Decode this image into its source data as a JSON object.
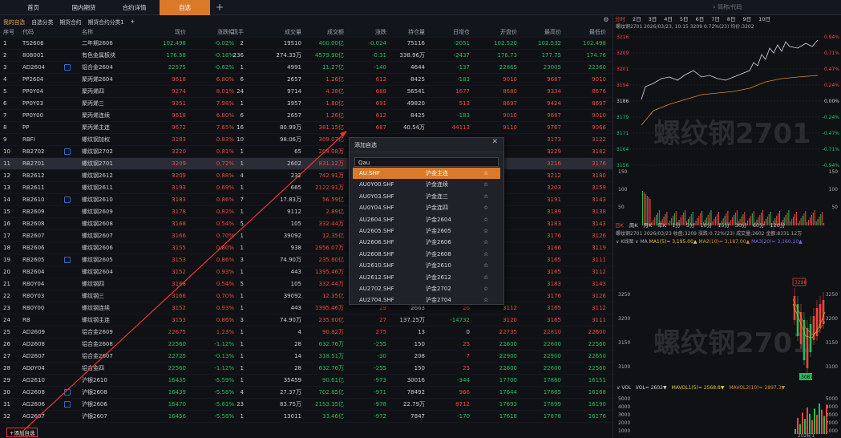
{
  "top_tabs": [
    "首页",
    "国内期货",
    "合约详情",
    "自选"
  ],
  "search_placeholder": "简称/代码",
  "subtabs": [
    "我的自选",
    "自选分类",
    "期货合约",
    "期货合约分类1",
    "+"
  ],
  "columns": [
    "序号",
    "代码",
    "名称",
    "现价",
    "涨跌幅",
    "现手",
    "成交量",
    "成交额",
    "涨跌",
    "持仓量",
    "日增仓",
    "开盘价",
    "最高价",
    "最低价"
  ],
  "rows": [
    [
      "1",
      "TS2606",
      "二年期2606",
      "102.498",
      "-0.02%",
      "2",
      "19510",
      "400.00亿",
      "-0.024",
      "75116",
      "-2051",
      "102.520",
      "102.532",
      "102.498"
    ],
    [
      "2",
      "808001",
      "有色金属板块",
      "176.58",
      "-0.18%",
      "236",
      "274.33万",
      "4579.90亿",
      "-0.31",
      "338.96万",
      "-2437",
      "176.73",
      "177.75",
      "174.76"
    ],
    [
      "3",
      "AD2604",
      "铝合金2604",
      "22575",
      "-0.62%",
      "1",
      "4991",
      "11.27亿",
      "-140",
      "4644",
      "-137",
      "22865",
      "23005",
      "22360"
    ],
    [
      "4",
      "PP2604",
      "聚丙烯2604",
      "9618",
      "6.80%",
      "6",
      "2657",
      "1.26亿",
      "612",
      "8425",
      "-183",
      "9010",
      "9687",
      "9010"
    ],
    [
      "5",
      "PP0Y04",
      "聚丙烯四",
      "9274",
      "8.01%",
      "24",
      "9714",
      "4.38亿",
      "688",
      "56541",
      "1677",
      "8680",
      "9334",
      "8676"
    ],
    [
      "6",
      "PP0Y03",
      "聚丙烯三",
      "9351",
      "7.98%",
      "1",
      "3957",
      "1.80亿",
      "691",
      "49820",
      "513",
      "8697",
      "9424",
      "8697"
    ],
    [
      "7",
      "PP0Y00",
      "聚丙烯连续",
      "9618",
      "6.80%",
      "6",
      "2657",
      "1.26亿",
      "612",
      "8425",
      "-183",
      "9010",
      "9687",
      "9010"
    ],
    [
      "8",
      "PP",
      "聚丙烯主连",
      "9672",
      "7.65%",
      "16",
      "80.99万",
      "381.15亿",
      "687",
      "40.54万",
      "44113",
      "9110",
      "9767",
      "9066"
    ],
    [
      "9",
      "RBFI",
      "螺纹钢加权",
      "3183",
      "0.83%",
      "10",
      "98.06万",
      "309.07亿",
      "",
      "",
      "",
      "",
      "3173",
      "3122"
    ],
    [
      "10",
      "RB2702",
      "螺纹钢2702",
      "3220",
      "0.81%",
      "1",
      "65",
      "209.08万",
      "",
      "",
      "",
      "",
      "3229",
      "3182"
    ],
    [
      "11",
      "RB2701",
      "螺纹钢2701",
      "3209",
      "0.72%",
      "1",
      "2602",
      "831.12万",
      "",
      "",
      "",
      "",
      "3216",
      "3176"
    ],
    [
      "12",
      "RB2612",
      "螺纹钢2612",
      "3209",
      "0.88%",
      "4",
      "232",
      "742.91万",
      "",
      "",
      "",
      "",
      "3212",
      "3180"
    ],
    [
      "13",
      "RB2611",
      "螺纹钢2611",
      "3193",
      "0.69%",
      "1",
      "665",
      "2122.91万",
      "",
      "",
      "",
      "",
      "3203",
      "3159"
    ],
    [
      "14",
      "RB2610",
      "螺纹钢2610",
      "3183",
      "0.86%",
      "7",
      "17.83万",
      "56.59亿",
      "",
      "",
      "",
      "",
      "3191",
      "3143"
    ],
    [
      "15",
      "RB2609",
      "螺纹钢2609",
      "3178",
      "0.82%",
      "1",
      "9112",
      "2.89亿",
      "",
      "",
      "",
      "",
      "3189",
      "3138"
    ],
    [
      "16",
      "RB2608",
      "螺纹钢2608",
      "3168",
      "0.54%",
      "5",
      "105",
      "332.44万",
      "",
      "",
      "",
      "",
      "3183",
      "3143"
    ],
    [
      "17",
      "RB2607",
      "螺纹钢2607",
      "3166",
      "0.70%",
      "1",
      "39092",
      "12.35亿",
      "",
      "",
      "",
      "",
      "3176",
      "3126"
    ],
    [
      "18",
      "RB2606",
      "螺纹钢2606",
      "3155",
      "0.80%",
      "1",
      "938",
      "2956.07万",
      "",
      "",
      "",
      "",
      "3166",
      "3119"
    ],
    [
      "19",
      "RB2605",
      "螺纹钢2605",
      "3153",
      "0.86%",
      "3",
      "74.90万",
      "235.60亿",
      "",
      "",
      "",
      "",
      "3165",
      "3111"
    ],
    [
      "20",
      "RB2604",
      "螺纹钢2604",
      "3152",
      "0.93%",
      "1",
      "443",
      "1395.46万",
      "",
      "",
      "",
      "",
      "3165",
      "3112"
    ],
    [
      "21",
      "RB0Y04",
      "螺纹钢四",
      "3168",
      "0.54%",
      "5",
      "105",
      "332.44万",
      "",
      "",
      "",
      "",
      "3183",
      "3143"
    ],
    [
      "22",
      "RB0Y03",
      "螺纹钢三",
      "3166",
      "0.70%",
      "1",
      "39092",
      "12.35亿",
      "",
      "",
      "",
      "",
      "3176",
      "3126"
    ],
    [
      "23",
      "RB0Y00",
      "螺纹钢连续",
      "3152",
      "0.93%",
      "1",
      "443",
      "1395.46万",
      "29",
      "2663",
      "26",
      "3112",
      "3165",
      "3112"
    ],
    [
      "24",
      "RB",
      "螺纹钢主连",
      "3153",
      "0.86%",
      "3",
      "74.90万",
      "235.60亿",
      "27",
      "137.25万",
      "-14732",
      "3120",
      "3165",
      "3111"
    ],
    [
      "25",
      "AD2609",
      "铝合金2609",
      "22675",
      "1.23%",
      "1",
      "4",
      "90.82万",
      "275",
      "13",
      "0",
      "22735",
      "22810",
      "22600"
    ],
    [
      "26",
      "AD2608",
      "铝合金2608",
      "22560",
      "-1.12%",
      "1",
      "28",
      "632.76万",
      "-255",
      "150",
      "25",
      "22600",
      "22600",
      "22560"
    ],
    [
      "27",
      "AD2607",
      "铝合金2607",
      "22725",
      "-0.13%",
      "1",
      "14",
      "318.51万",
      "-30",
      "208",
      "7",
      "22900",
      "22900",
      "22650"
    ],
    [
      "28",
      "AD0Y04",
      "铝合金四",
      "22560",
      "-1.12%",
      "1",
      "28",
      "632.76万",
      "-255",
      "150",
      "25",
      "22600",
      "22600",
      "22560"
    ],
    [
      "29",
      "AG2610",
      "沪银2610",
      "16435",
      "-5.59%",
      "1",
      "35459",
      "90.61亿",
      "-973",
      "30016",
      "-344",
      "17700",
      "17860",
      "16151"
    ],
    [
      "30",
      "AG2608",
      "沪银2608",
      "16439",
      "-5.58%",
      "4",
      "27.37万",
      "702.85亿",
      "-971",
      "78492",
      "966",
      "17644",
      "17865",
      "16168"
    ],
    [
      "31",
      "AG2606",
      "沪银2606",
      "16470",
      "-5.61%",
      "23",
      "83.75万",
      "2153.35亿",
      "-978",
      "22.79万",
      "8712",
      "17693",
      "17899",
      "16190"
    ],
    [
      "32",
      "AG2607",
      "沪银2607",
      "16456",
      "-5.58%",
      "1",
      "13011",
      "33.46亿",
      "-972",
      "7847",
      "-170",
      "17618",
      "17878",
      "16176"
    ]
  ],
  "add_button": "+添加自选",
  "dialog": {
    "title": "添加自选",
    "search": "au",
    "items": [
      [
        "AU.SHF",
        "沪金主连"
      ],
      [
        "AU0Y00.SHF",
        "沪金连续"
      ],
      [
        "AU0Y03.SHF",
        "沪金连三"
      ],
      [
        "AU0Y04.SHF",
        "沪金连四"
      ],
      [
        "AU2604.SHF",
        "沪金2604"
      ],
      [
        "AU2605.SHF",
        "沪金2605"
      ],
      [
        "AU2606.SHF",
        "沪金2606"
      ],
      [
        "AU2608.SHF",
        "沪金2608"
      ],
      [
        "AU2610.SHF",
        "沪金2610"
      ],
      [
        "AU2612.SHF",
        "沪金2612"
      ],
      [
        "AU2702.SHF",
        "沪金2702"
      ],
      [
        "AU2704.SHF",
        "沪金2704"
      ]
    ]
  },
  "right": {
    "time_tabs": [
      "分时",
      "2日",
      "3日",
      "4日",
      "5日",
      "6日",
      "7日",
      "8日",
      "9日",
      "10日"
    ],
    "time_info": "螺纹钢2701  2026/03/23, 10:15  3209  0.72%(23)  均价:3202",
    "price_levels": [
      "3216",
      "3209",
      "3201",
      "3194",
      "3186",
      "3179",
      "3171",
      "3164",
      "3156"
    ],
    "pct_levels": [
      "0.94%",
      "0.71%",
      "0.47%",
      "0.24%",
      "0.00%",
      "-0.24%",
      "-0.47%",
      "-0.71%",
      "-0.94%"
    ],
    "vol_levels": [
      "150",
      "100",
      "50"
    ],
    "time_axis": [
      "21:00",
      "22:00",
      "23:00",
      "10:00",
      "11:30",
      "14:30"
    ],
    "k_tabs": [
      "日K",
      "周K",
      "月K",
      "年K",
      "1分",
      "5分",
      "10分",
      "15分",
      "30分",
      "60分",
      "120分"
    ],
    "k_info": "螺纹钢2701  2026/03/23  收盘:3209  涨跌:0.72%(23)  成交量:2602  金额:8331.12万",
    "ma_info": [
      "∨ K线图 ∨ MA",
      "MA1(5)= 3,195.00▲",
      "MA2(10)= 3,187.00▲",
      "MA3(20)= 3,160.10▲"
    ],
    "k_levels": [
      "3250",
      "3200",
      "3150",
      "3100"
    ],
    "k_marks": [
      "3298",
      "3087"
    ],
    "vol_info": [
      "∨ VOL",
      "VOL= 2602▼",
      "MAVOL1(5)= 2568.8▼",
      "MAVOL2(10)= 2897.3▼"
    ],
    "kvol_levels": [
      "5000",
      "4000",
      "3000",
      "2000",
      "1000"
    ],
    "k_date": "2026/1",
    "watermark": "螺纹钢2701",
    "colors": {
      "up": "#f2453a",
      "down": "#20c05a",
      "accent": "#d97a2b"
    }
  }
}
